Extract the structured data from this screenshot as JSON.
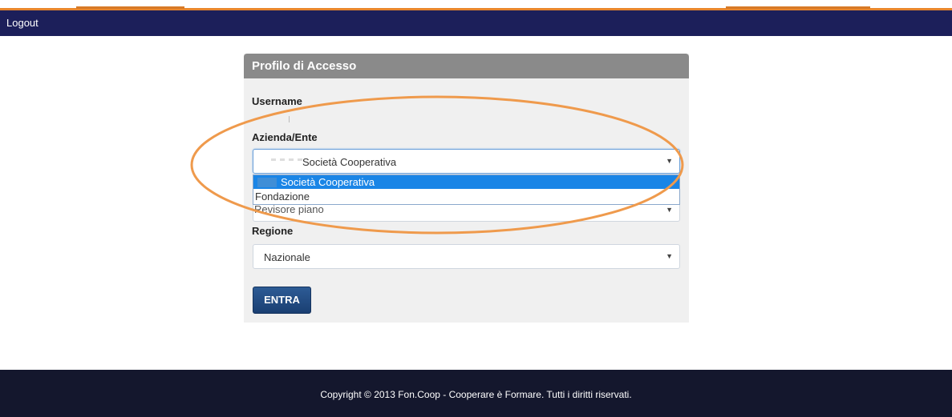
{
  "navbar": {
    "logout_label": "Logout"
  },
  "panel": {
    "title": "Profilo di Accesso",
    "username_label": "Username",
    "azienda_label": "Azienda/Ente",
    "azienda_selected": "Società Cooperativa",
    "azienda_options": [
      "Società Cooperativa",
      "Fondazione",
      "Revisore piano"
    ],
    "regione_label": "Regione",
    "regione_selected": "Nazionale",
    "submit_label": "ENTRA"
  },
  "footer": {
    "copyright": "Copyright © 2013 Fon.Coop - Cooperare è Formare. Tutti i diritti riservati."
  },
  "colors": {
    "navbar": "#1c1f5a",
    "accent": "#e8862c",
    "button": "#1a3f72",
    "footer": "#14172d",
    "highlight": "#1a85e6"
  },
  "icons": {
    "select_caret": "caret-down-icon"
  }
}
